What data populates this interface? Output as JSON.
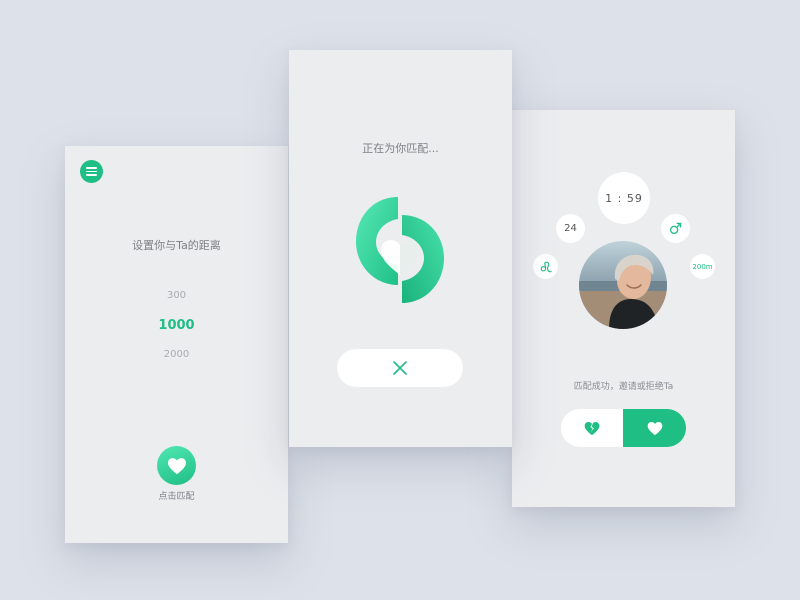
{
  "screen1": {
    "title": "设置你与Ta的距离",
    "distance_options": [
      "300",
      "1000",
      "2000"
    ],
    "selected_distance": "1000",
    "match_label": "点击匹配",
    "menu_icon": "hamburger-menu-icon",
    "match_icon": "heart-icon"
  },
  "screen2": {
    "status": "正在为你匹配...",
    "logo_icon": "split-heart-logo-icon",
    "cancel_icon": "close-icon"
  },
  "screen3": {
    "timer": "1 : 59",
    "age": "24",
    "gender_symbol": "♂",
    "zodiac_symbol": "♌",
    "distance": "200m",
    "avatar": "avatar-photo",
    "success_text": "匹配成功，邀请或拒绝Ta",
    "reject_icon": "broken-heart-icon",
    "accept_icon": "heart-icon"
  },
  "colors": {
    "accent": "#1fbe85",
    "accent_light": "#50e7b3",
    "card_bg": "#ebedef",
    "page_bg": "#dde1e9",
    "muted_text": "#a9acb1",
    "text": "#7d8086"
  }
}
